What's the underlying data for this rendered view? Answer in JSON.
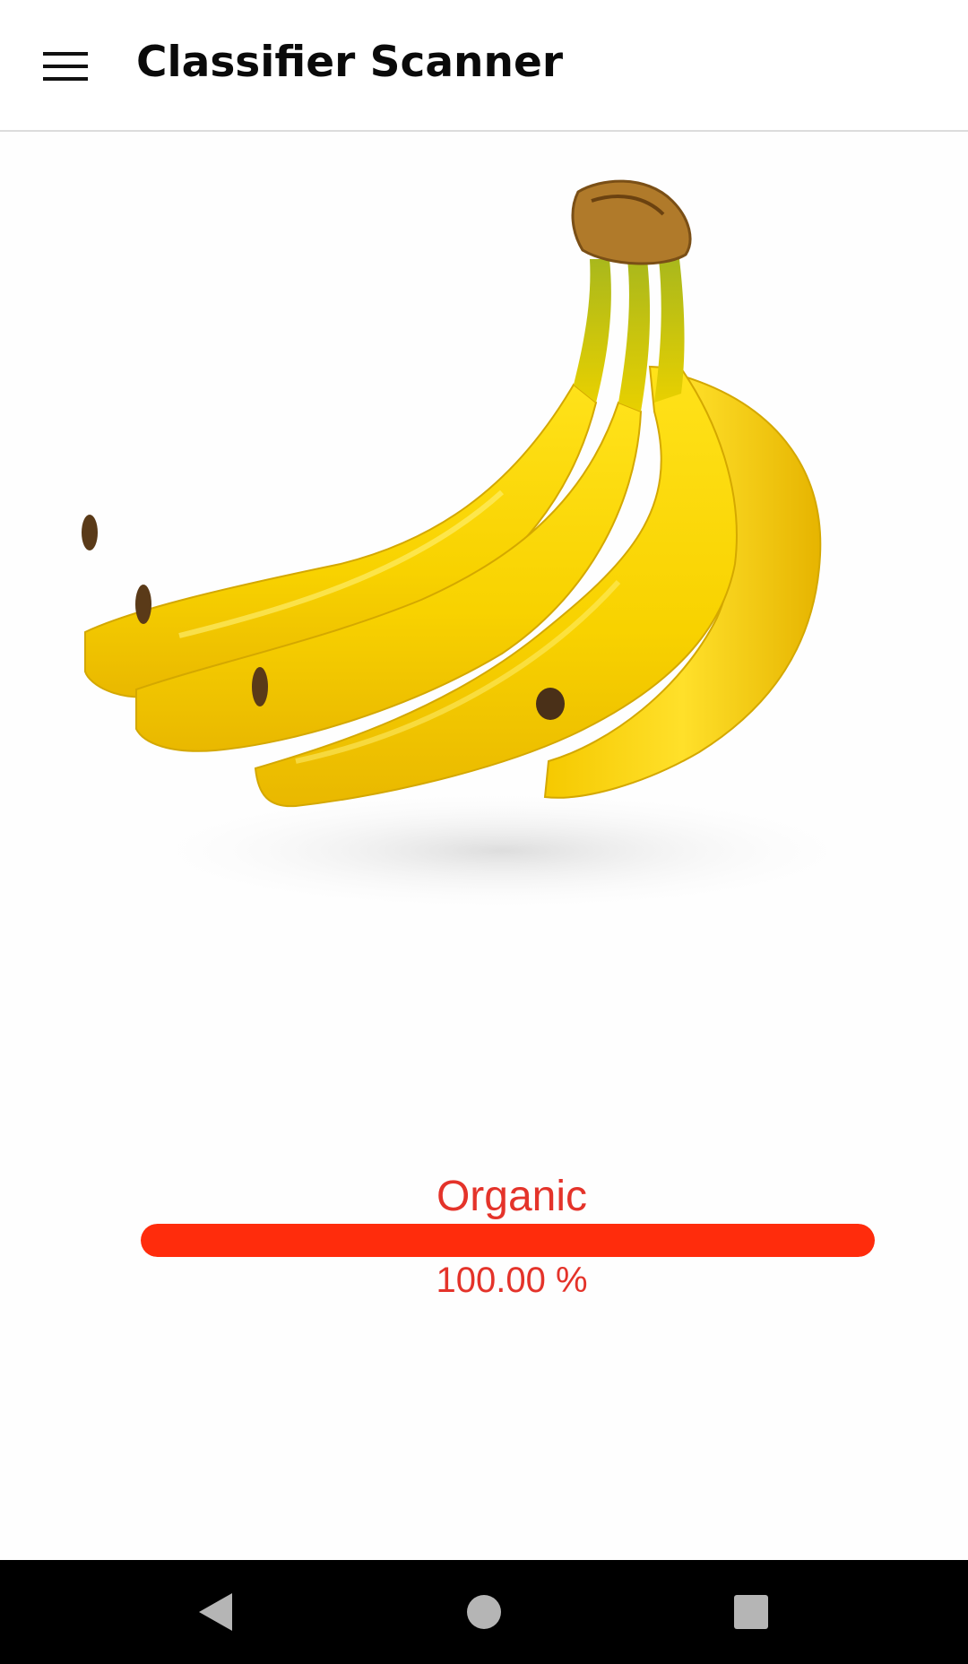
{
  "app_bar": {
    "title": "Classifier Scanner",
    "menu_icon": "hamburger-menu-icon"
  },
  "scanned_image": {
    "subject": "bunch of bananas"
  },
  "classification": {
    "label": "Organic",
    "confidence_text": "100.00 %",
    "confidence_fraction": 1.0,
    "color": "#e4332a",
    "bar_color": "#ff2c0c"
  },
  "system_nav": {
    "back_icon": "back-triangle-icon",
    "home_icon": "home-circle-icon",
    "recents_icon": "recents-square-icon"
  }
}
